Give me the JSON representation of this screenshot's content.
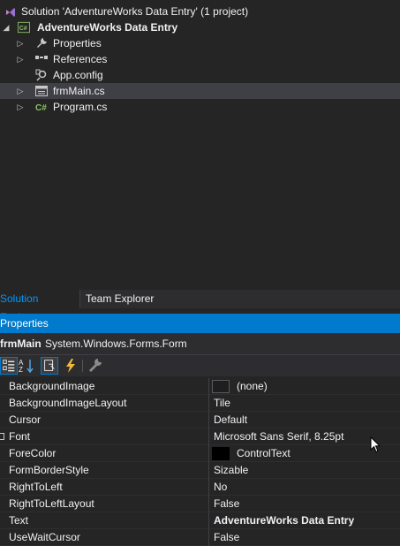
{
  "solution_explorer": {
    "solution_label": "Solution 'AdventureWorks Data Entry' (1 project)",
    "project_label": "AdventureWorks Data Entry",
    "items": [
      {
        "label": "Properties",
        "icon": "wrench-icon"
      },
      {
        "label": "References",
        "icon": "references-icon"
      },
      {
        "label": "App.config",
        "icon": "config-icon"
      },
      {
        "label": "frmMain.cs",
        "icon": "form-icon",
        "selected": true
      },
      {
        "label": "Program.cs",
        "icon": "csharp-icon"
      }
    ]
  },
  "tabs": {
    "solution_explorer": "Solution Explorer",
    "team_explorer": "Team Explorer"
  },
  "properties": {
    "title": "Properties",
    "object_name": "frmMain",
    "object_type": "System.Windows.Forms.Form",
    "rows": [
      {
        "name": "BackgroundImage",
        "value": "(none)"
      },
      {
        "name": "BackgroundImageLayout",
        "value": "Tile"
      },
      {
        "name": "Cursor",
        "value": "Default"
      },
      {
        "name": "Font",
        "value": "Microsoft Sans Serif, 8.25pt"
      },
      {
        "name": "ForeColor",
        "value": "ControlText"
      },
      {
        "name": "FormBorderStyle",
        "value": "Sizable"
      },
      {
        "name": "RightToLeft",
        "value": "No"
      },
      {
        "name": "RightToLeftLayout",
        "value": "False"
      },
      {
        "name": "Text",
        "value": "AdventureWorks Data Entry"
      },
      {
        "name": "UseWaitCursor",
        "value": "False"
      }
    ]
  },
  "colors": {
    "accent": "#007acc",
    "selection": "#3f3f46",
    "active_tab_text": "#0097fb"
  }
}
